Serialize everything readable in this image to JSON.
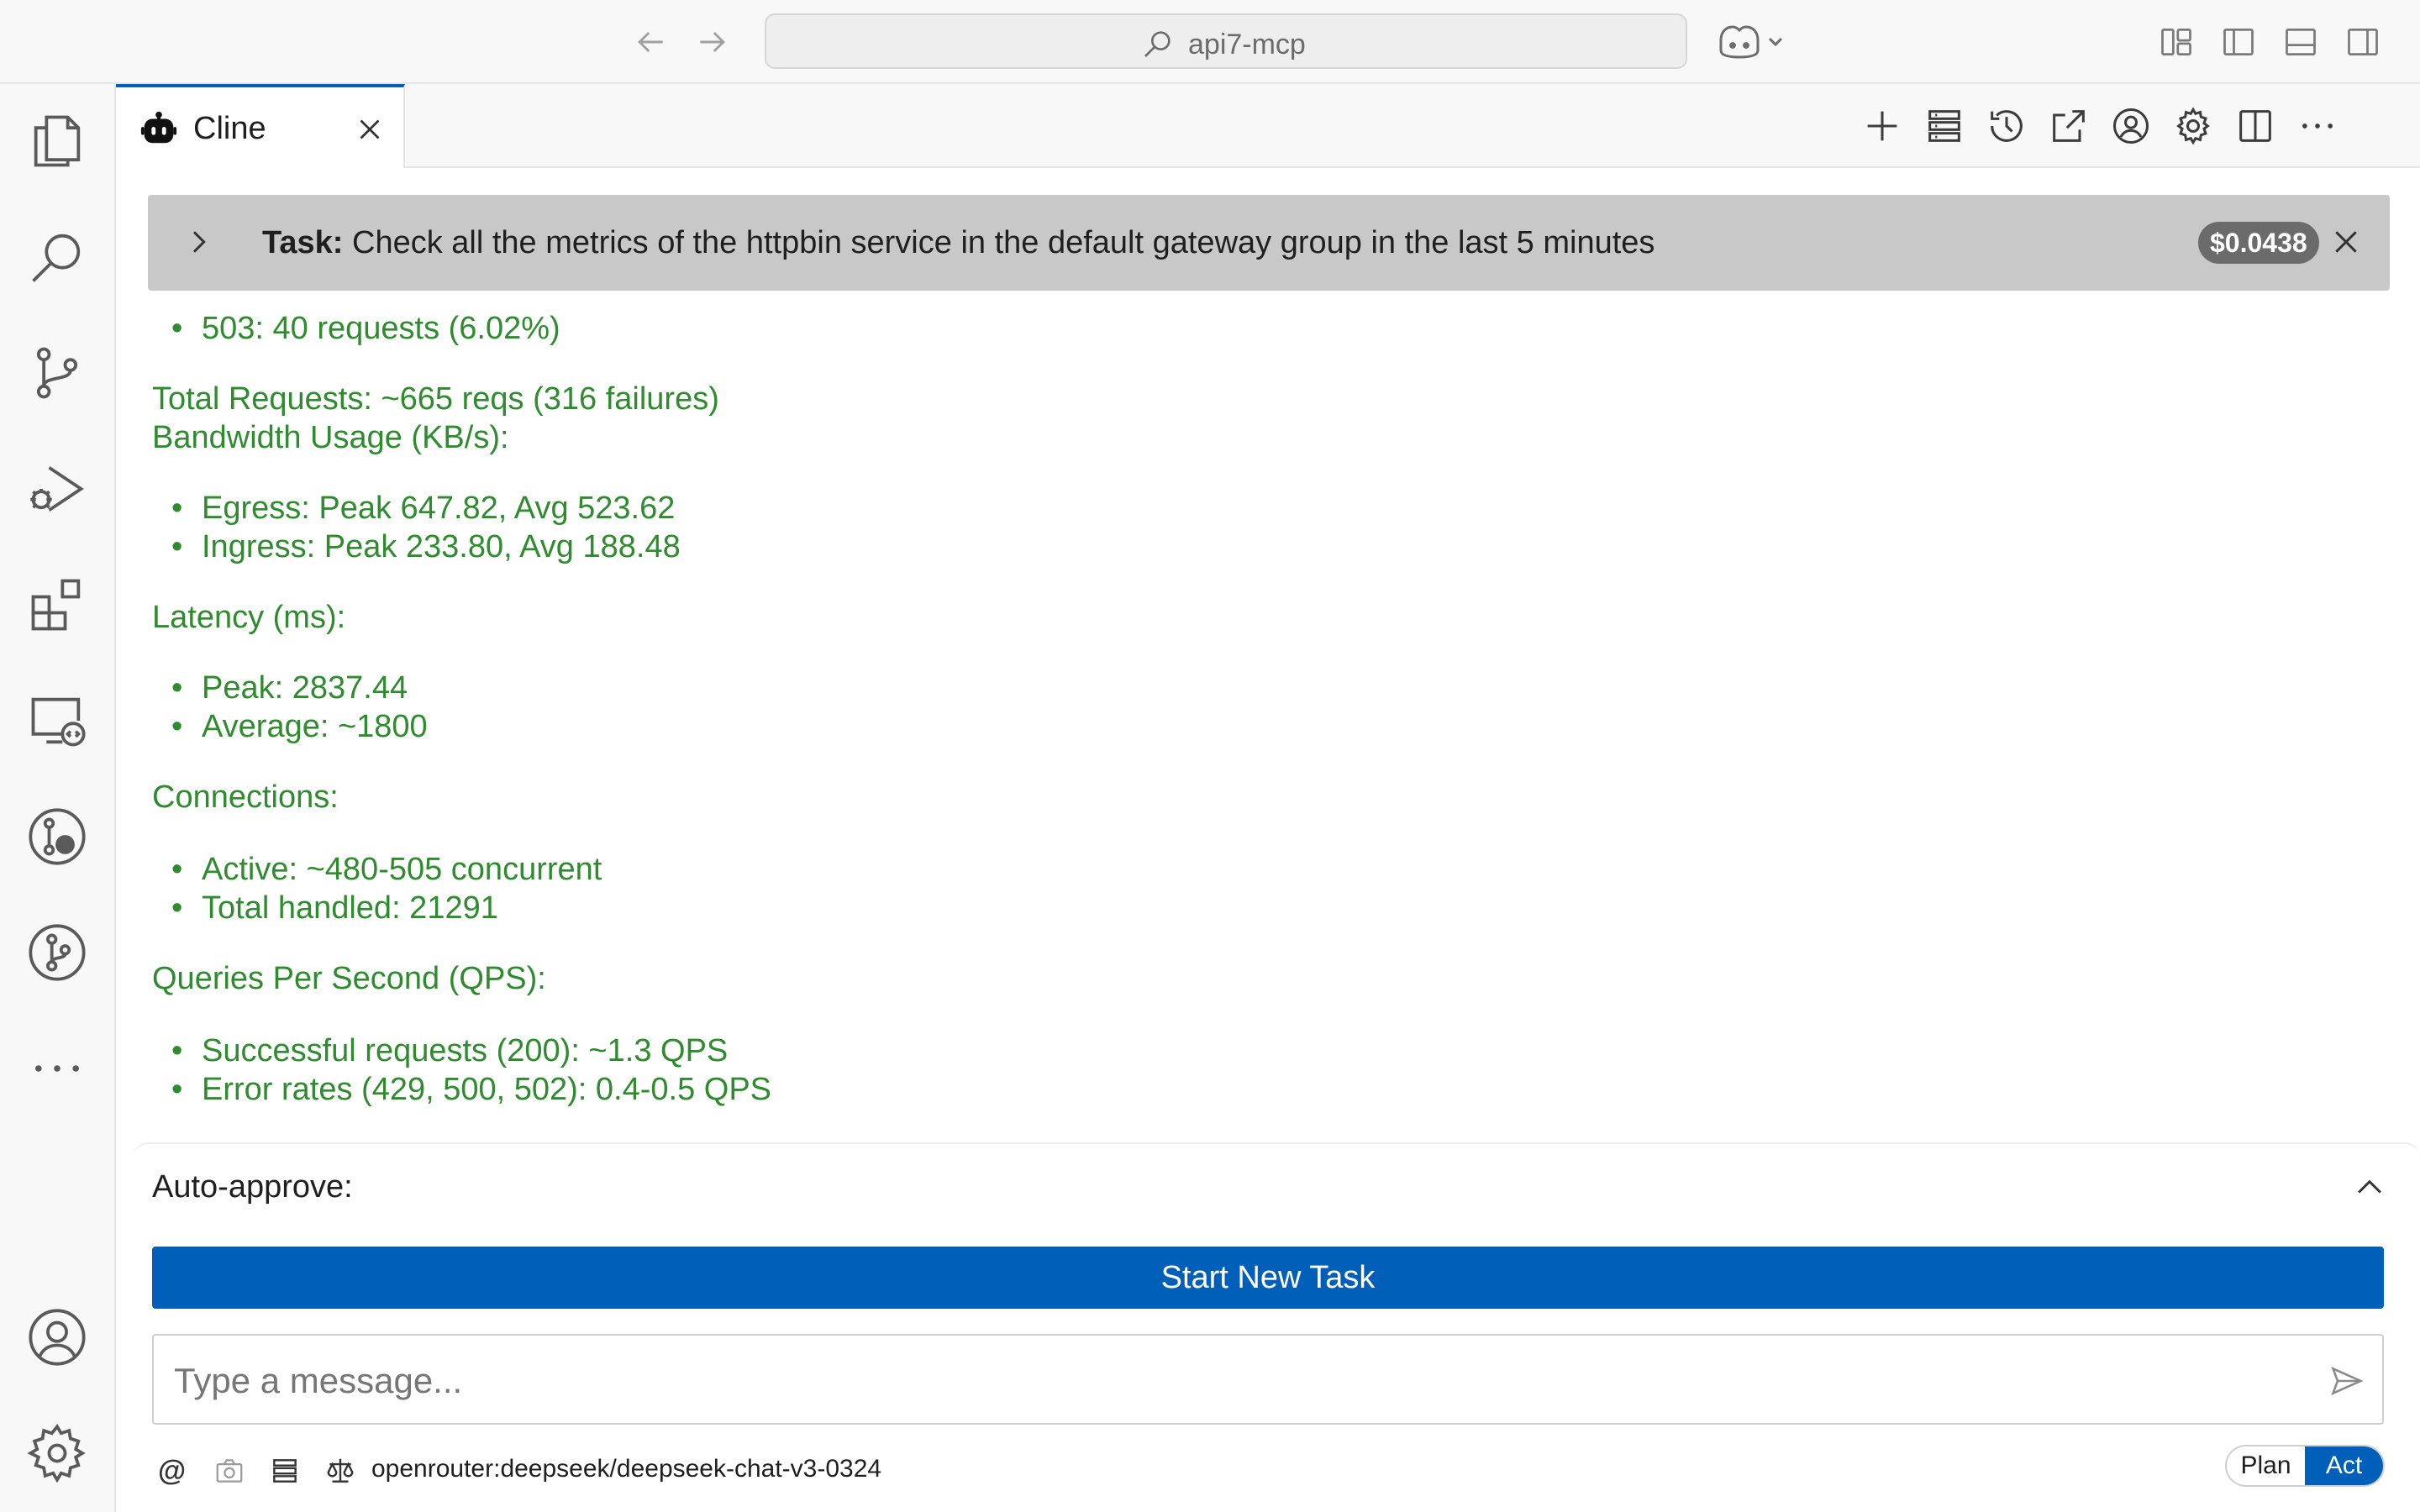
{
  "titlebar": {
    "search_text": "api7-mcp",
    "icons": [
      "back-arrow-icon",
      "forward-arrow-icon",
      "search-icon",
      "copilot-icon",
      "customize-layout-icon",
      "toggle-primary-sidebar-icon",
      "toggle-panel-icon",
      "toggle-secondary-sidebar-icon"
    ]
  },
  "activitybar": {
    "items": [
      "explorer-icon",
      "search-icon",
      "source-control-icon",
      "run-debug-icon",
      "extensions-icon",
      "remote-explorer-icon",
      "gitlens-icon",
      "git-graph-icon",
      "more-icon",
      "accounts-icon",
      "manage-gear-icon"
    ]
  },
  "tab": {
    "label": "Cline"
  },
  "task": {
    "prefix": "Task:",
    "text": " Check all the metrics of the httpbin service in the default gateway group in the last 5 minutes",
    "cost": "$0.0438"
  },
  "messages": {
    "b503": "503: 40 requests (6.02%)",
    "total_requests": "Total Requests: ~665 reqs (316 failures)",
    "bandwidth_heading": "Bandwidth Usage (KB/s):",
    "egress": "Egress: Peak 647.82, Avg 523.62",
    "ingress": "Ingress: Peak 233.80, Avg 188.48",
    "latency_heading": "Latency (ms):",
    "latency_peak": "Peak: 2837.44",
    "latency_avg": "Average: ~1800",
    "connections_heading": "Connections:",
    "conn_active": "Active: ~480-505 concurrent",
    "conn_total": "Total handled: 21291",
    "qps_heading": "Queries Per Second (QPS):",
    "qps_success": "Successful requests (200): ~1.3 QPS",
    "qps_error": "Error rates (429, 500, 502): 0.4-0.5 QPS"
  },
  "bottom": {
    "auto_approve": "Auto-approve:",
    "start_new_task": "Start New Task",
    "input_placeholder": "Type a message...",
    "model": "openrouter:deepseek/deepseek-chat-v3-0324",
    "mode_plan": "Plan",
    "mode_act": "Act",
    "at_symbol": "@"
  },
  "colors": {
    "accent": "#005fb8",
    "message_green": "#2e8b2e",
    "task_bar_bg": "#c8c8c8"
  }
}
